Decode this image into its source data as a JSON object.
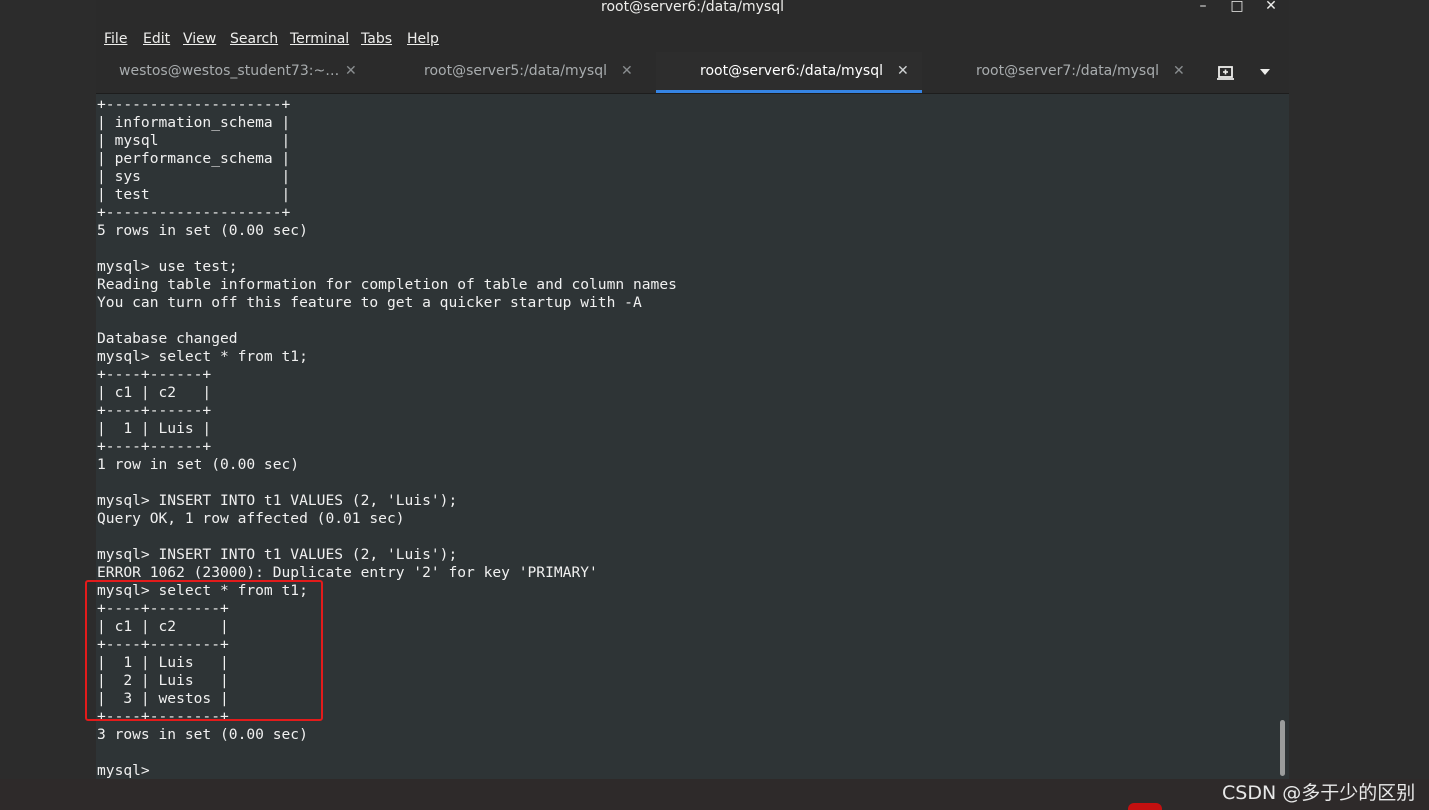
{
  "window": {
    "title": "root@server6:/data/mysql",
    "controls": {
      "minimize": "–",
      "maximize": "□",
      "close": "✕"
    }
  },
  "menu": [
    {
      "label": "File"
    },
    {
      "label": "Edit"
    },
    {
      "label": "View"
    },
    {
      "label": "Search"
    },
    {
      "label": "Terminal"
    },
    {
      "label": "Tabs"
    },
    {
      "label": "Help"
    }
  ],
  "tabs": [
    {
      "label": "westos@westos_student73:~…",
      "close": "✕",
      "active": false
    },
    {
      "label": "root@server5:/data/mysql",
      "close": "✕",
      "active": false
    },
    {
      "label": "root@server6:/data/mysql",
      "close": "✕",
      "active": true
    },
    {
      "label": "root@server7:/data/mysql",
      "close": "✕",
      "active": false
    }
  ],
  "tab_actions": {
    "new_tab_icon": "new-tab-icon",
    "menu_icon": "chevron-down-icon"
  },
  "terminal": {
    "lines": [
      "+--------------------+",
      "| information_schema |",
      "| mysql              |",
      "| performance_schema |",
      "| sys                |",
      "| test               |",
      "+--------------------+",
      "5 rows in set (0.00 sec)",
      "",
      "mysql> use test;",
      "Reading table information for completion of table and column names",
      "You can turn off this feature to get a quicker startup with -A",
      "",
      "Database changed",
      "mysql> select * from t1;",
      "+----+------+",
      "| c1 | c2   |",
      "+----+------+",
      "|  1 | Luis |",
      "+----+------+",
      "1 row in set (0.00 sec)",
      "",
      "mysql> INSERT INTO t1 VALUES (2, 'Luis');",
      "Query OK, 1 row affected (0.01 sec)",
      "",
      "mysql> INSERT INTO t1 VALUES (2, 'Luis');",
      "ERROR 1062 (23000): Duplicate entry '2' for key 'PRIMARY'",
      "mysql> select * from t1;",
      "+----+--------+",
      "| c1 | c2     |",
      "+----+--------+",
      "|  1 | Luis   |",
      "|  2 | Luis   |",
      "|  3 | westos |",
      "+----+--------+",
      "3 rows in set (0.00 sec)",
      "",
      "mysql> "
    ]
  },
  "watermark": "CSDN @多于少的区别",
  "colors": {
    "terminal_bg": "#2e3436",
    "terminal_fg": "#f0f0f0",
    "active_tab_underline": "#3584e4",
    "highlight_box": "#e31b1b"
  }
}
